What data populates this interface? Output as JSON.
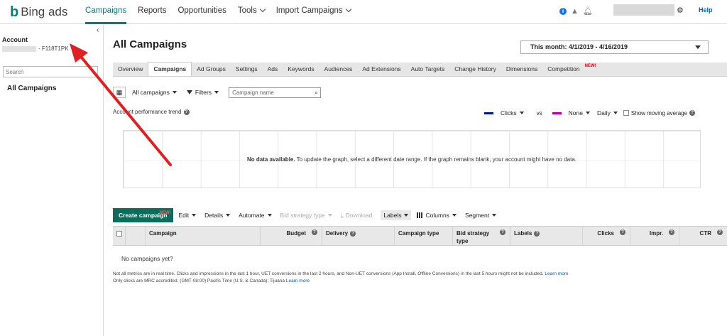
{
  "brand": {
    "name": "Bing ads",
    "color": "#008272"
  },
  "nav": {
    "items": [
      {
        "label": "Campaigns",
        "active": true
      },
      {
        "label": "Reports"
      },
      {
        "label": "Opportunities"
      },
      {
        "label": "Tools",
        "dropdown": true
      },
      {
        "label": "Import Campaigns",
        "dropdown": true
      }
    ]
  },
  "topbar": {
    "help_label": "Help"
  },
  "sidebar": {
    "account_label": "Account",
    "account_id": "- F118T1PK",
    "search_placeholder": "Search",
    "all_campaigns": "All Campaigns"
  },
  "main": {
    "title": "All Campaigns",
    "date_range": "This month: 4/1/2019 - 4/16/2019",
    "tabs": [
      {
        "label": "Overview"
      },
      {
        "label": "Campaigns",
        "active": true
      },
      {
        "label": "Ad Groups"
      },
      {
        "label": "Settings"
      },
      {
        "label": "Ads"
      },
      {
        "label": "Keywords"
      },
      {
        "label": "Audiences"
      },
      {
        "label": "Ad Extensions"
      },
      {
        "label": "Auto Targets"
      },
      {
        "label": "Change History"
      },
      {
        "label": "Dimensions"
      },
      {
        "label": "Competition",
        "badge": "NEW!"
      }
    ],
    "filters": {
      "all_campaigns": "All campaigns",
      "filters": "Filters",
      "campaign_search_placeholder": "Campaign name"
    },
    "trend": {
      "label": "Account performance trend",
      "metric1": "Clicks",
      "metric1_color": "#00188f",
      "vs": "vs",
      "metric2": "None",
      "metric2_color": "#b4009e",
      "granularity": "Daily",
      "moving_average": "Show moving average"
    },
    "graph": {
      "no_data_bold": "No data available.",
      "no_data_text": " To update the graph, select a different date range. If the graph remains blank, your account might have no data."
    },
    "toolbar": {
      "create": "Create campaign",
      "create_badge": "NEW!",
      "edit": "Edit",
      "details": "Details",
      "automate": "Automate",
      "bid_strategy": "Bid strategy type",
      "download": "Download",
      "labels": "Labels",
      "columns": "Columns",
      "segment": "Segment"
    },
    "grid": {
      "columns": [
        "Campaign",
        "Budget",
        "Delivery",
        "Campaign type",
        "Bid strategy type",
        "Labels",
        "Clicks",
        "Impr.",
        "CTR"
      ],
      "empty": "No campaigns yet?"
    },
    "footnote": {
      "line1": "Not all metrics are in real time. Clicks and impressions in the last 1 hour, UET conversions in the last 2 hours, and Non-UET conversions (App Install, Offline Conversions) in the last 5 hours might not be included. ",
      "line2": "Only clicks are MRC accredited. (GMT-08:00) Pacific Time (U.S. & Canada); Tijuana ",
      "link": "Learn more"
    }
  }
}
